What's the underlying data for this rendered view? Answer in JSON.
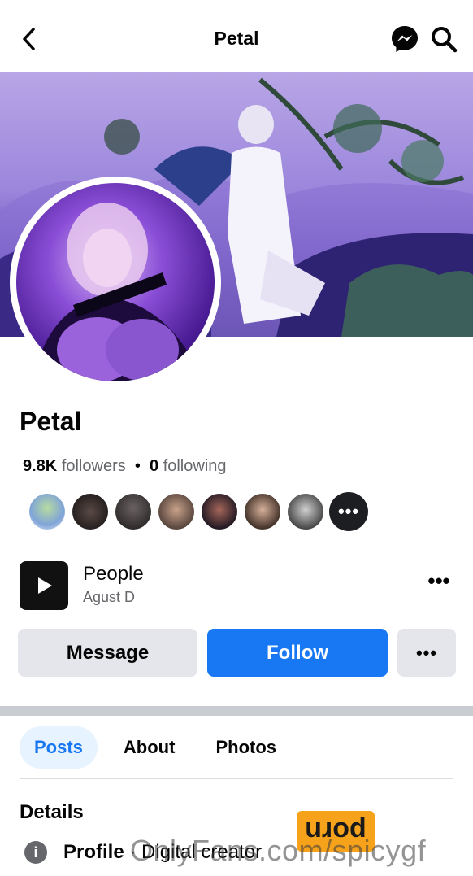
{
  "header": {
    "title": "Petal",
    "back_icon": "chevron-left-icon",
    "messenger_icon": "messenger-icon",
    "search_icon": "search-icon"
  },
  "profile": {
    "name": "Petal",
    "followers_count": "9.8K",
    "followers_label": "followers",
    "separator": "•",
    "following_count": "0",
    "following_label": "following",
    "friend_avatars_more": "•••"
  },
  "music": {
    "title": "People",
    "artist": "Agust D",
    "more_label": "•••"
  },
  "actions": {
    "message_label": "Message",
    "follow_label": "Follow",
    "more_label": "•••"
  },
  "tabs": [
    {
      "label": "Posts",
      "active": true
    },
    {
      "label": "About",
      "active": false
    },
    {
      "label": "Photos",
      "active": false
    }
  ],
  "details": {
    "title": "Details",
    "row_prefix": "Profile",
    "row_separator": "·",
    "row_text": "Digital creator"
  },
  "overlay": {
    "badge_text": "porn",
    "watermark_text": "OnlyFans.com/spicygf"
  },
  "colors": {
    "accent": "#1877f2",
    "secondary_button": "#e4e6eb",
    "muted_text": "#65676b",
    "badge": "#f7a21b"
  }
}
